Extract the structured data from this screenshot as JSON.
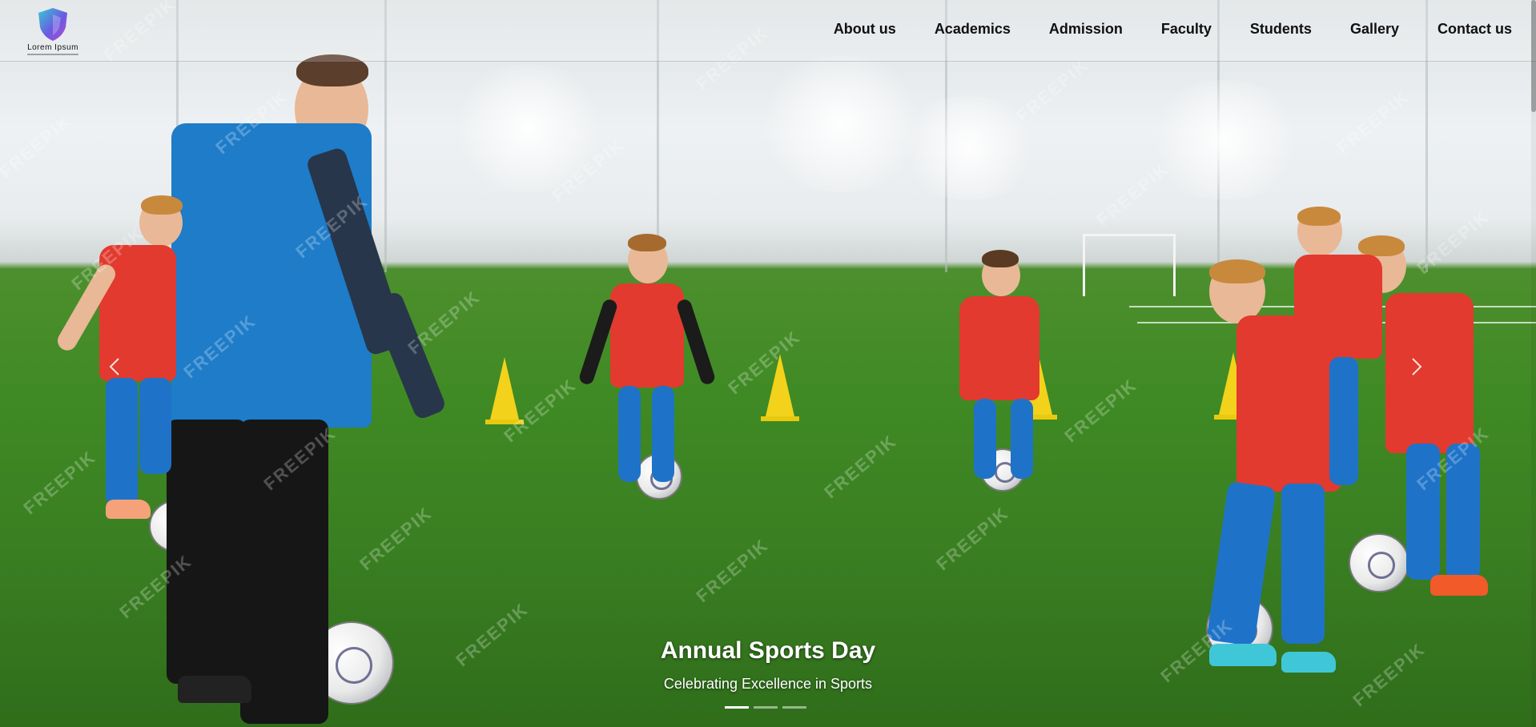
{
  "brand": {
    "logo_text": "Lorem Ipsum"
  },
  "nav": {
    "items": [
      {
        "label": "About us"
      },
      {
        "label": "Academics"
      },
      {
        "label": "Admission"
      },
      {
        "label": "Faculty"
      },
      {
        "label": "Students"
      },
      {
        "label": "Gallery"
      },
      {
        "label": "Contact us"
      }
    ]
  },
  "carousel": {
    "title": "Annual Sports Day",
    "subtitle": "Celebrating Excellence in Sports",
    "slide_count": 3,
    "active_slide": 1,
    "prev_icon": "chevron-left-icon",
    "next_icon": "chevron-right-icon"
  },
  "watermark_text": "FREEPIK",
  "colors": {
    "jersey_blue": "#1e73c8",
    "bib_red": "#e23a2e",
    "turf_green": "#3f8a24",
    "cone_yellow": "#f2d21a"
  }
}
